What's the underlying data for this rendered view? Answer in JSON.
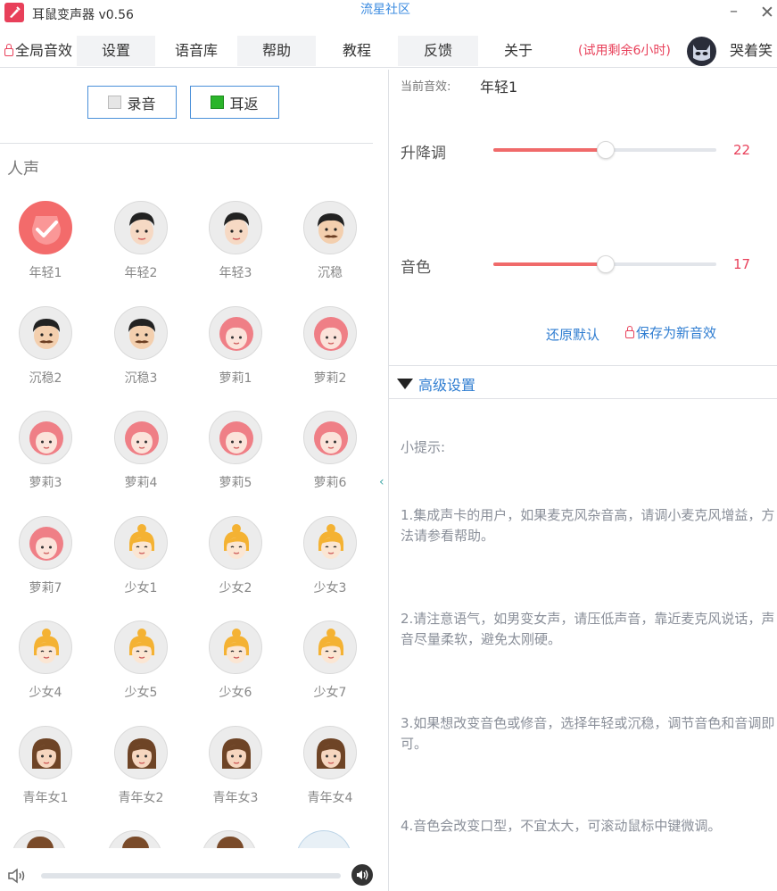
{
  "titlebar": {
    "app_title": "耳鼠变声器 v0.56",
    "community": "流星社区",
    "minimize": "–",
    "close": "✕"
  },
  "menu": {
    "items": [
      "全局音效",
      "设置",
      "语音库",
      "帮助",
      "教程",
      "反馈",
      "关于"
    ],
    "trial": "(试用剩余6小时)",
    "username": "哭着笑"
  },
  "controls": {
    "record": "录音",
    "monitor": "耳返"
  },
  "section": "人声",
  "voices": [
    {
      "label": "年轻1",
      "kind": "selected"
    },
    {
      "label": "年轻2",
      "kind": "young"
    },
    {
      "label": "年轻3",
      "kind": "young"
    },
    {
      "label": "沉稳",
      "kind": "mature"
    },
    {
      "label": "沉稳2",
      "kind": "mature"
    },
    {
      "label": "沉稳3",
      "kind": "mature"
    },
    {
      "label": "萝莉1",
      "kind": "loli"
    },
    {
      "label": "萝莉2",
      "kind": "loli"
    },
    {
      "label": "萝莉3",
      "kind": "loli"
    },
    {
      "label": "萝莉4",
      "kind": "loli"
    },
    {
      "label": "萝莉5",
      "kind": "loli"
    },
    {
      "label": "萝莉6",
      "kind": "loli"
    },
    {
      "label": "萝莉7",
      "kind": "loli"
    },
    {
      "label": "少女1",
      "kind": "girl"
    },
    {
      "label": "少女2",
      "kind": "girl"
    },
    {
      "label": "少女3",
      "kind": "girl"
    },
    {
      "label": "少女4",
      "kind": "girl"
    },
    {
      "label": "少女5",
      "kind": "girl"
    },
    {
      "label": "少女6",
      "kind": "girl"
    },
    {
      "label": "少女7",
      "kind": "girl"
    },
    {
      "label": "青年女1",
      "kind": "woman"
    },
    {
      "label": "青年女2",
      "kind": "woman"
    },
    {
      "label": "青年女3",
      "kind": "woman"
    },
    {
      "label": "青年女4",
      "kind": "woman"
    }
  ],
  "right": {
    "current_label": "当前音效:",
    "current_value": "年轻1",
    "pitch_label": "升降调",
    "pitch_value": "22",
    "timbre_label": "音色",
    "timbre_value": "17",
    "restore": "还原默认",
    "save": "保存为新音效",
    "advanced": "高级设置",
    "tips_title": "小提示:",
    "tip1": "1.集成声卡的用户，如果麦克风杂音高，请调小麦克风增益，方法请参看帮助。",
    "tip2": "2.请注意语气，如男变女声，请压低声音，靠近麦克风说话，声音尽量柔软，避免太刚硬。",
    "tip3": "3.如果想改变音色或修音，选择年轻或沉稳，调节音色和音调即可。",
    "tip4": "4.音色会改变口型，不宜太大，可滚动鼠标中键微调。"
  },
  "colors": {
    "accent_red": "#f06a6a",
    "link_blue": "#2f7dd1",
    "monitor_green": "#2bb52b"
  }
}
